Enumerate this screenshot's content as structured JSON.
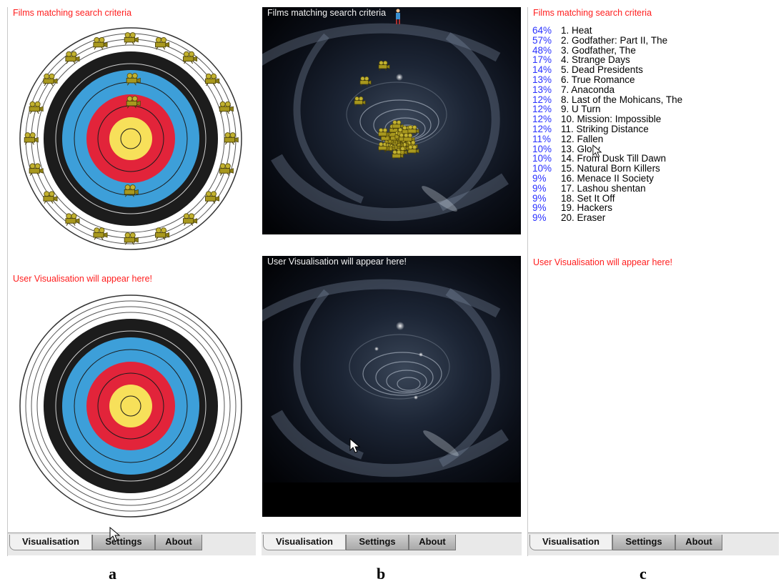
{
  "panels": {
    "a": {
      "films_heading": "Films matching search criteria",
      "user_heading": "User Visualisation will appear here!",
      "caption": "a"
    },
    "b": {
      "films_heading": "Films matching search criteria",
      "user_heading": "User Visualisation will appear here!",
      "caption": "b"
    },
    "c": {
      "films_heading": "Films matching search criteria",
      "user_heading": "User Visualisation will appear here!",
      "caption": "c"
    }
  },
  "tabs": {
    "visualisation": "Visualisation",
    "settings": "Settings",
    "about": "About",
    "active": "Visualisation"
  },
  "results": [
    {
      "pct": "64%",
      "title": "1. Heat"
    },
    {
      "pct": "57%",
      "title": "2. Godfather: Part II, The"
    },
    {
      "pct": "48%",
      "title": "3. Godfather, The"
    },
    {
      "pct": "17%",
      "title": "4. Strange Days"
    },
    {
      "pct": "14%",
      "title": "5. Dead Presidents"
    },
    {
      "pct": "13%",
      "title": "6. True Romance"
    },
    {
      "pct": "13%",
      "title": "7. Anaconda"
    },
    {
      "pct": "12%",
      "title": "8. Last of the Mohicans, The"
    },
    {
      "pct": "12%",
      "title": "9. U Turn"
    },
    {
      "pct": "12%",
      "title": "10. Mission: Impossible"
    },
    {
      "pct": "12%",
      "title": "11. Striking Distance"
    },
    {
      "pct": "11%",
      "title": "12. Fallen"
    },
    {
      "pct": "10%",
      "title": "13. Glory"
    },
    {
      "pct": "10%",
      "title": "14. From Dusk Till Dawn"
    },
    {
      "pct": "10%",
      "title": "15. Natural Born Killers"
    },
    {
      "pct": "9%",
      "title": "16. Menace II Society"
    },
    {
      "pct": "9%",
      "title": "17. Lashou shentan"
    },
    {
      "pct": "9%",
      "title": "18. Set It Off"
    },
    {
      "pct": "9%",
      "title": "19. Hackers"
    },
    {
      "pct": "9%",
      "title": "20. Eraser"
    }
  ],
  "colors": {
    "heading_red": "#ff1e1e",
    "percent_blue": "#2a32ff",
    "target_yellow": "#f7e05a",
    "target_red": "#e2243a",
    "target_blue": "#3d9fd9",
    "target_black": "#1c1c1c",
    "projector_icon": "#b5a52a"
  },
  "icons": {
    "film_item": "film-projector-icon",
    "user": "user-figure-icon",
    "pointer": "mouse-pointer-icon"
  }
}
